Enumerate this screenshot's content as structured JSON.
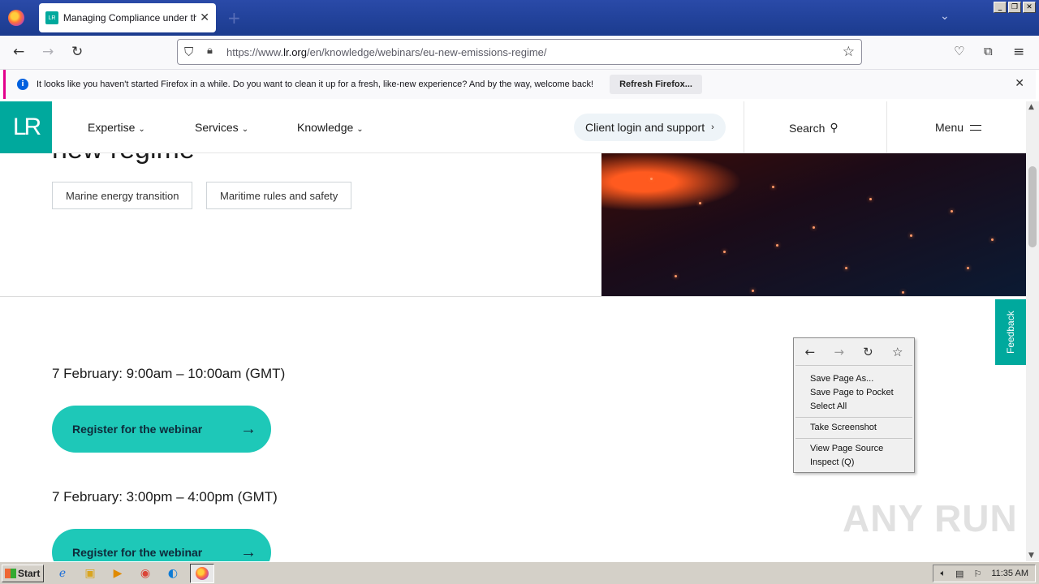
{
  "browser": {
    "tab_title": "Managing Compliance under the EU",
    "tab_favicon": "LR",
    "url_host": "lr.org",
    "url_prefix": "https://www.",
    "url_path": "/en/knowledge/webinars/eu-new-emissions-regime/",
    "notification_text": "It looks like you haven't started Firefox in a while. Do you want to clean it up for a fresh, like-new experience? And by the way, welcome back!",
    "notification_button": "Refresh Firefox..."
  },
  "site_header": {
    "logo": "LR",
    "menu": [
      "Expertise",
      "Services",
      "Knowledge"
    ],
    "client_login": "Client login and support",
    "search": "Search",
    "menu_label": "Menu"
  },
  "hero": {
    "title_cut": "new regime",
    "tags": [
      "Marine energy transition",
      "Maritime rules and safety"
    ]
  },
  "sessions": [
    {
      "time": "7 February: 9:00am – 10:00am (GMT)",
      "button": "Register for the webinar"
    },
    {
      "time": "7 February: 3:00pm – 4:00pm (GMT)",
      "button": "Register for the webinar"
    }
  ],
  "feedback": "Feedback",
  "context_menu": {
    "items": [
      "Save Page As...",
      "Save Page to Pocket",
      "Select All",
      "Take Screenshot",
      "View Page Source",
      "Inspect (Q)"
    ]
  },
  "watermark": "ANY RUN",
  "taskbar": {
    "start": "Start",
    "clock": "11:35 AM"
  }
}
